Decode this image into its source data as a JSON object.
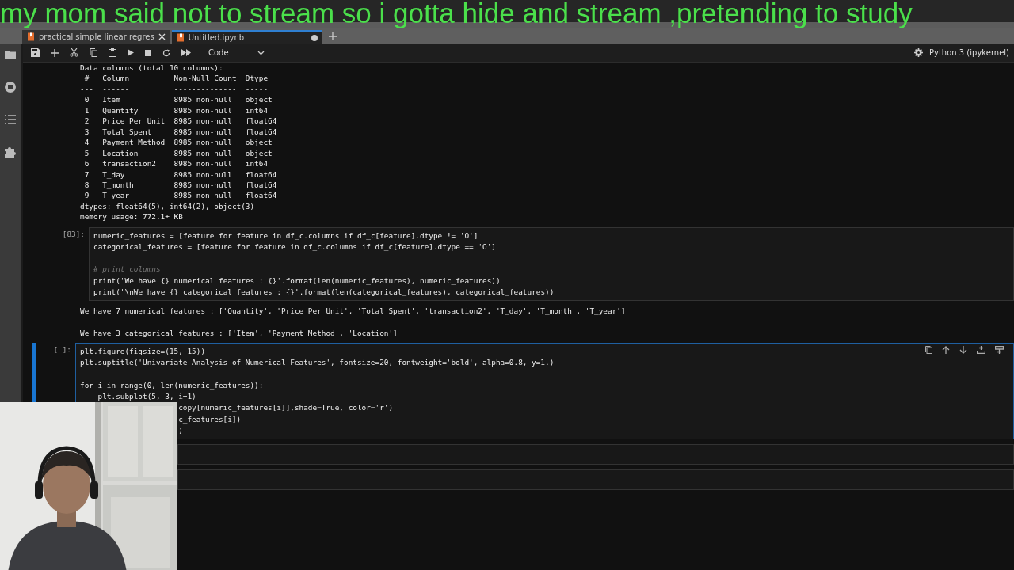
{
  "overlay_caption": "my mom said not to stream so i gotta hide and stream ,pretending to study",
  "tabs": [
    {
      "label": "practical simple linear regres",
      "selected": false,
      "modified": false
    },
    {
      "label": "Untitled.ipynb",
      "selected": true,
      "modified": true
    }
  ],
  "toolbar": {
    "cell_type": "Code",
    "kernel": "Python 3 (ipykernel)"
  },
  "cells": [
    {
      "kind": "output",
      "lines": [
        {
          "kind": "text",
          "text": "Data columns (total 10 columns):"
        },
        {
          "kind": "text",
          "text": " #   Column          Non-Null Count  Dtype"
        },
        {
          "kind": "text",
          "text": "---  ------          --------------  -----"
        },
        {
          "kind": "text",
          "text": " 0   Item            8985 non-null   object"
        },
        {
          "kind": "text",
          "text": " 1   Quantity        8985 non-null   int64"
        },
        {
          "kind": "text",
          "text": " 2   Price Per Unit  8985 non-null   float64"
        },
        {
          "kind": "text",
          "text": " 3   Total Spent     8985 non-null   float64"
        },
        {
          "kind": "text",
          "text": " 4   Payment Method  8985 non-null   object"
        },
        {
          "kind": "text",
          "text": " 5   Location        8985 non-null   object"
        },
        {
          "kind": "text",
          "text": " 6   transaction2    8985 non-null   int64"
        },
        {
          "kind": "text",
          "text": " 7   T_day           8985 non-null   float64"
        },
        {
          "kind": "text",
          "text": " 8   T_month         8985 non-null   float64"
        },
        {
          "kind": "text",
          "text": " 9   T_year          8985 non-null   float64"
        },
        {
          "kind": "text",
          "text": "dtypes: float64(5), int64(2), object(3)"
        },
        {
          "kind": "text",
          "text": "memory usage: 772.1+ KB"
        }
      ]
    },
    {
      "kind": "code",
      "prompt": "[83]:",
      "active": false,
      "lines": [
        {
          "kind": "code",
          "text": "numeric_features = [feature for feature in df_c.columns if df_c[feature].dtype != 'O']"
        },
        {
          "kind": "code",
          "text": "categorical_features = [feature for feature in df_c.columns if df_c[feature].dtype == 'O']"
        },
        {
          "kind": "blank"
        },
        {
          "kind": "comment",
          "text": "# print columns"
        },
        {
          "kind": "code",
          "text": "print('We have {} numerical features : {}'.format(len(numeric_features), numeric_features))"
        },
        {
          "kind": "code",
          "text": "print('\\nWe have {} categorical features : {}'.format(len(categorical_features), categorical_features))"
        }
      ]
    },
    {
      "kind": "output",
      "lines": [
        {
          "kind": "text",
          "text": "We have 7 numerical features : ['Quantity', 'Price Per Unit', 'Total Spent', 'transaction2', 'T_day', 'T_month', 'T_year']"
        },
        {
          "kind": "blank"
        },
        {
          "kind": "text",
          "text": "We have 3 categorical features : ['Item', 'Payment Method', 'Location']"
        }
      ]
    },
    {
      "kind": "code",
      "prompt": "[ ]:",
      "active": true,
      "lines": [
        {
          "kind": "code",
          "text": "plt.figure(figsize=(15, 15))"
        },
        {
          "kind": "code",
          "text": "plt.suptitle('Univariate Analysis of Numerical Features', fontsize=20, fontweight='bold', alpha=0.8, y=1.)"
        },
        {
          "kind": "blank"
        },
        {
          "kind": "code",
          "text": "for i in range(0, len(numeric_features)):"
        },
        {
          "kind": "code",
          "text": "    plt.subplot(5, 3, i+1)"
        },
        {
          "kind": "covered",
          "text": "copy[numeric_features[i]],shade=True, color='r')"
        },
        {
          "kind": "covered",
          "text": "c_features[i])"
        },
        {
          "kind": "covered",
          "text": ")"
        }
      ]
    },
    {
      "kind": "empty"
    },
    {
      "kind": "empty"
    }
  ]
}
